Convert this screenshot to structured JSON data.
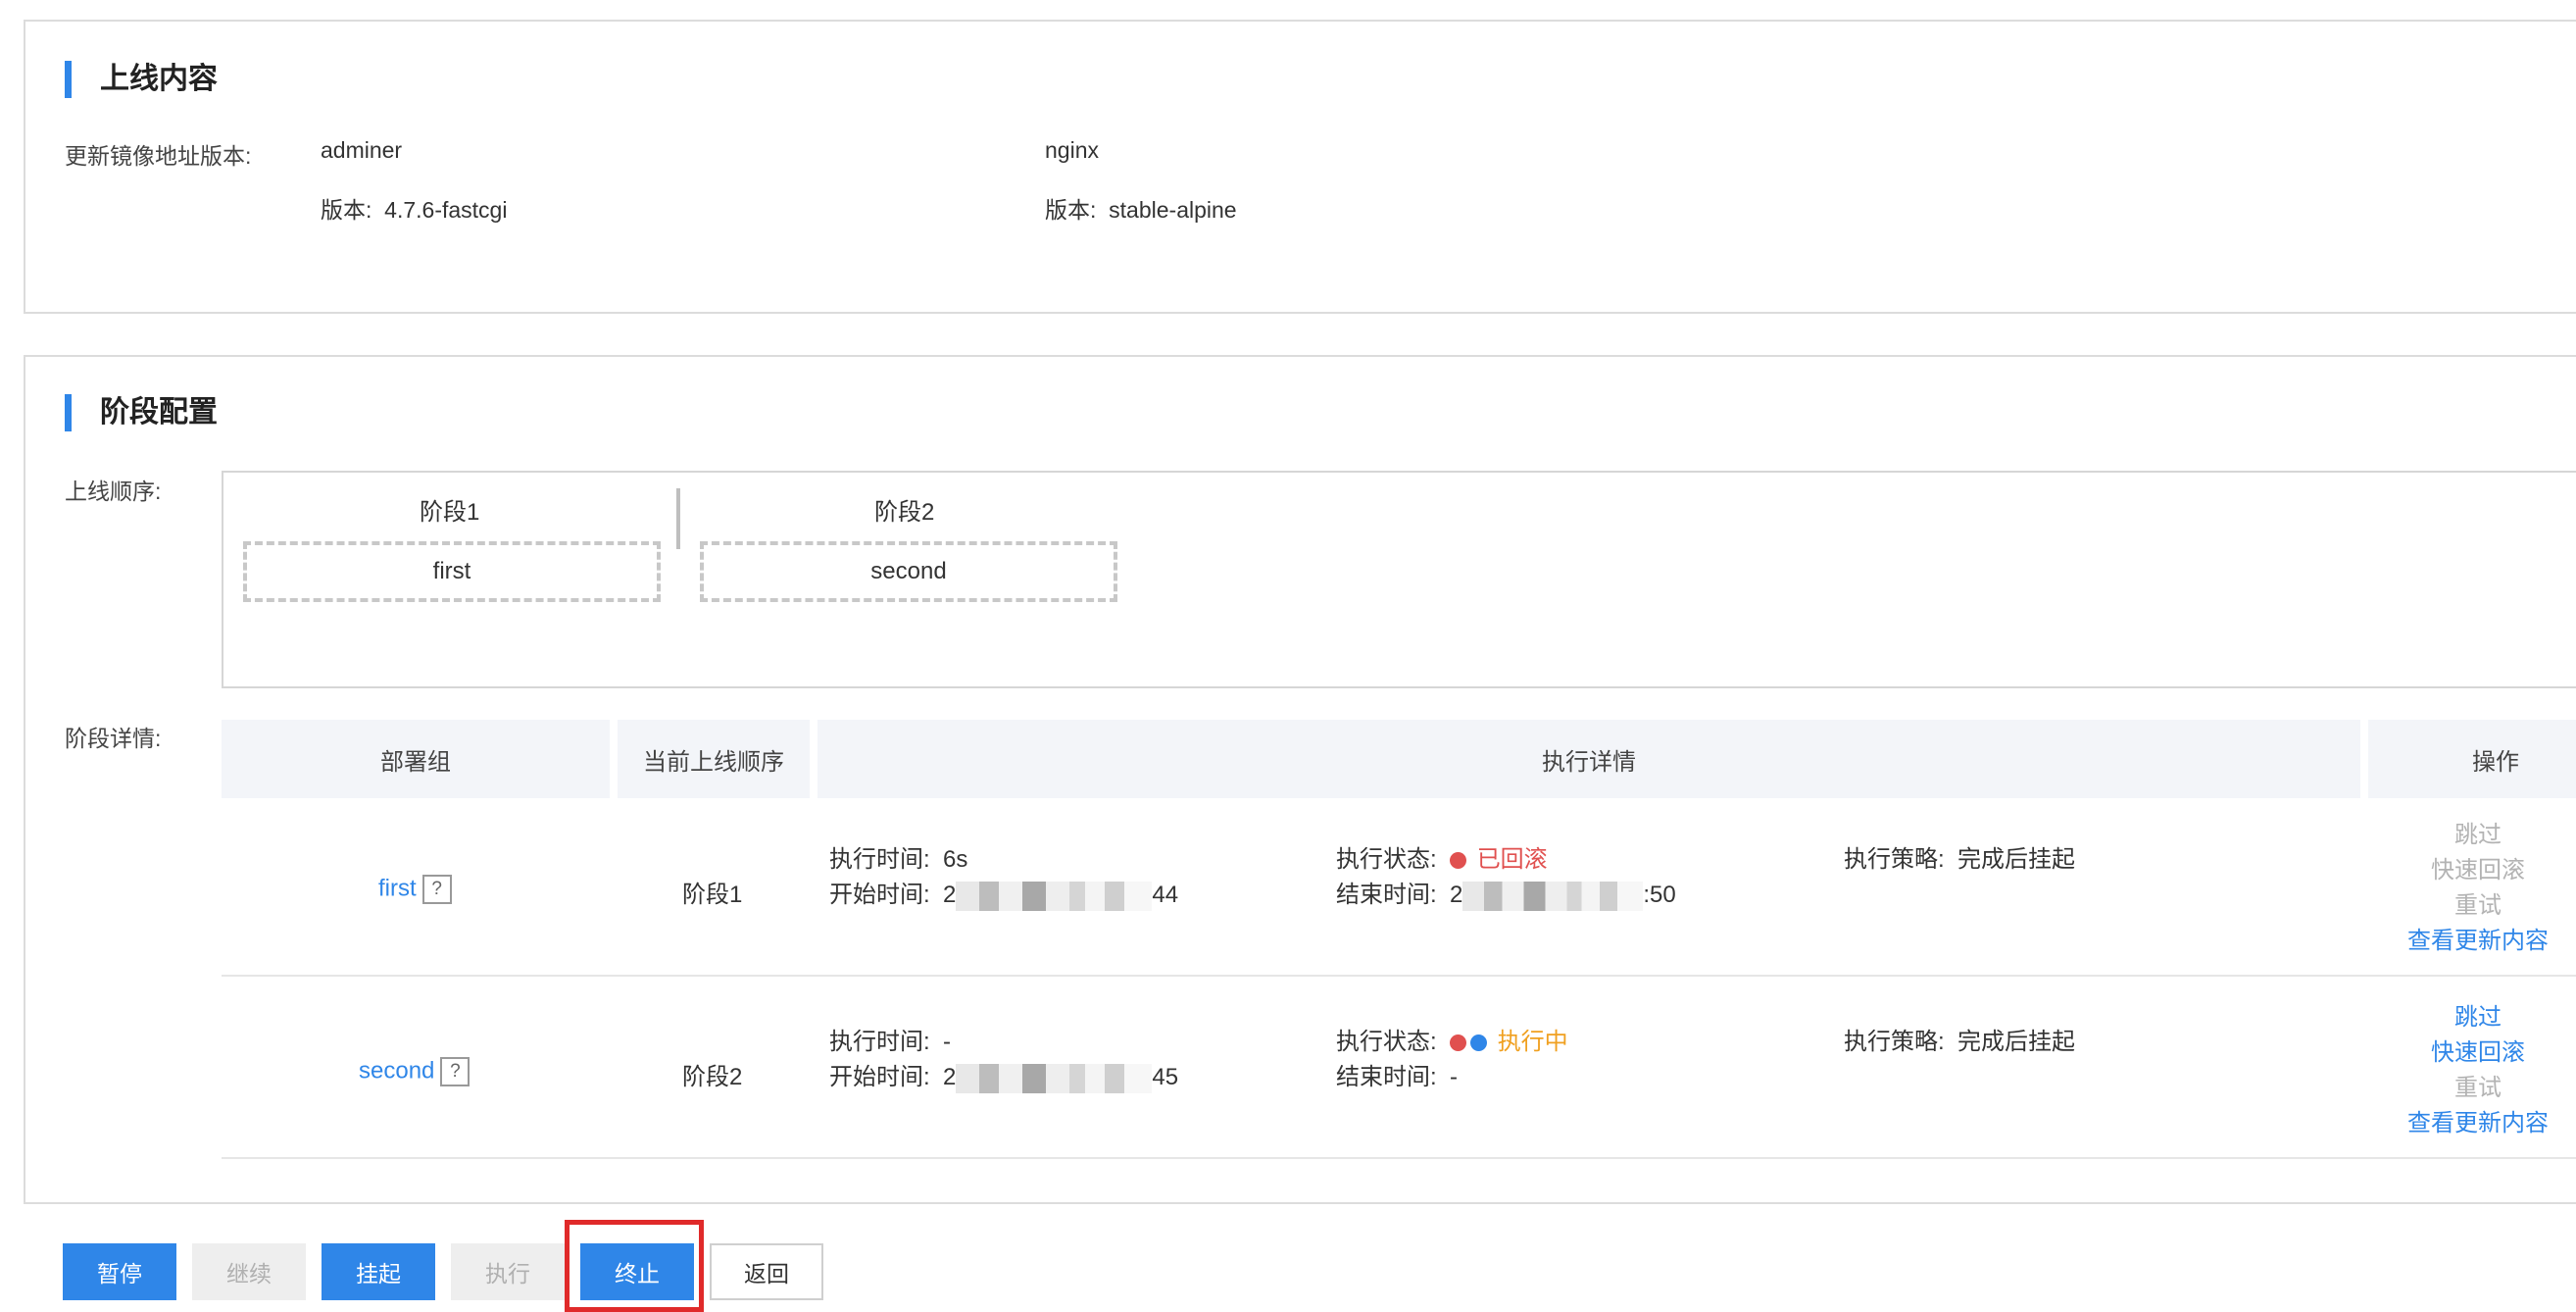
{
  "content_section": {
    "title": "上线内容",
    "image_label": "更新镜像地址版本:",
    "images": [
      {
        "name": "adminer",
        "version_label": "版本:",
        "version": "4.7.6-fastcgi"
      },
      {
        "name": "nginx",
        "version_label": "版本:",
        "version": "stable-alpine"
      }
    ]
  },
  "stage_section": {
    "title": "阶段配置",
    "order_label": "上线顺序:",
    "stages": [
      {
        "header": "阶段1",
        "group": "first"
      },
      {
        "header": "阶段2",
        "group": "second"
      }
    ],
    "detail_label": "阶段详情:",
    "table": {
      "headers": [
        "部署组",
        "当前上线顺序",
        "执行详情",
        "操作"
      ],
      "rows": [
        {
          "group": "first",
          "help": "?",
          "order": "阶段1",
          "exec_time_label": "执行时间:",
          "exec_time": "6s",
          "start_label": "开始时间:",
          "start_prefix": "2",
          "start_suffix": "44",
          "status_label": "执行状态:",
          "status": "已回滚",
          "end_label": "结束时间:",
          "end_prefix": "2",
          "end_suffix": ":50",
          "strategy_label": "执行策略:",
          "strategy": "完成后挂起",
          "ops": [
            "跳过",
            "快速回滚",
            "重试",
            "查看更新内容"
          ]
        },
        {
          "group": "second",
          "help": "?",
          "order": "阶段2",
          "exec_time_label": "执行时间:",
          "exec_time": "-",
          "start_label": "开始时间:",
          "start_prefix": "2",
          "start_suffix": "45",
          "status_label": "执行状态:",
          "status": "执行中",
          "end_label": "结束时间:",
          "end_value": "-",
          "strategy_label": "执行策略:",
          "strategy": "完成后挂起",
          "ops": [
            "跳过",
            "快速回滚",
            "重试",
            "查看更新内容"
          ]
        }
      ]
    }
  },
  "actions": {
    "pause": "暂停",
    "continue": "继续",
    "suspend": "挂起",
    "execute": "执行",
    "terminate": "终止",
    "back": "返回"
  },
  "colors": {
    "accent": "#2f86e8",
    "status_rolled_back": "#e0504f",
    "status_running": "#f0a020",
    "highlight": "#e02a2a"
  }
}
